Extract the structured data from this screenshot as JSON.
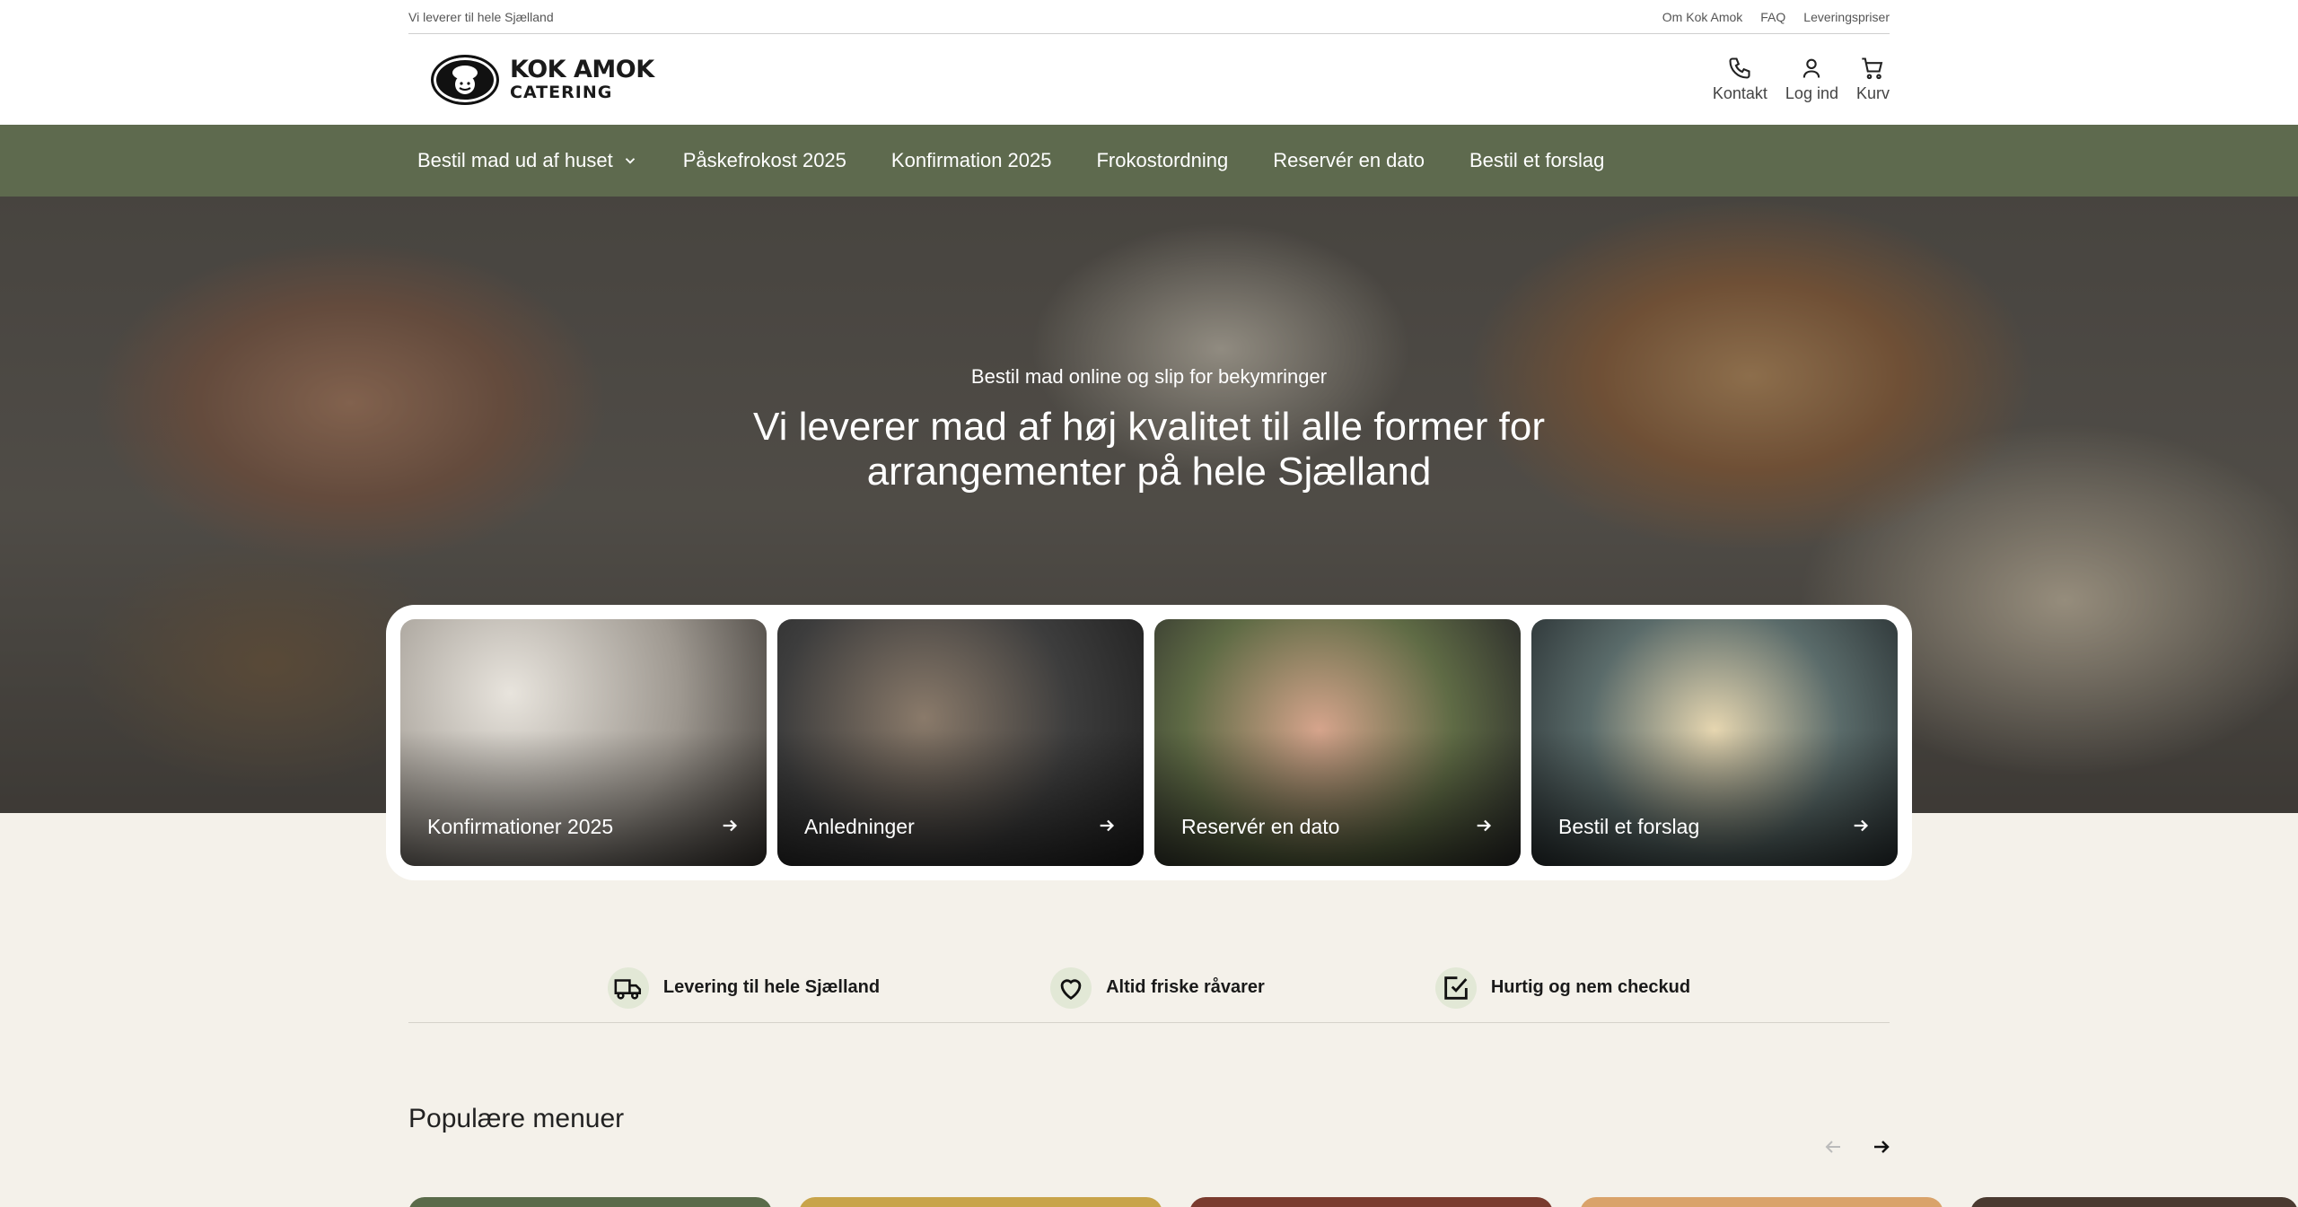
{
  "topbar": {
    "tagline": "Vi leverer til hele Sjælland",
    "links": [
      "Om Kok Amok",
      "FAQ",
      "Leveringspriser"
    ]
  },
  "header": {
    "logo_line1": "KOK AMOK",
    "logo_line2": "CATERING",
    "actions": [
      {
        "label": "Kontakt",
        "icon": "phone-icon"
      },
      {
        "label": "Log ind",
        "icon": "user-icon"
      },
      {
        "label": "Kurv",
        "icon": "cart-icon"
      }
    ]
  },
  "nav": {
    "items": [
      "Bestil mad ud af huset",
      "Påskefrokost 2025",
      "Konfirmation 2025",
      "Frokostordning",
      "Reservér en dato",
      "Bestil et forslag"
    ]
  },
  "hero": {
    "subtitle": "Bestil mad online og slip for bekymringer",
    "title_line1": "Vi leverer mad af høj kvalitet til alle former for",
    "title_line2": "arrangementer på hele Sjælland"
  },
  "cards": [
    {
      "label": "Konfirmationer 2025"
    },
    {
      "label": "Anledninger"
    },
    {
      "label": "Reservér en dato"
    },
    {
      "label": "Bestil et forslag"
    }
  ],
  "features": [
    {
      "label": "Levering til hele Sjælland",
      "icon": "truck-icon"
    },
    {
      "label": "Altid friske råvarer",
      "icon": "heart-icon"
    },
    {
      "label": "Hurtig og nem checkud",
      "icon": "check-icon"
    }
  ],
  "popular": {
    "title": "Populære menuer"
  },
  "colors": {
    "nav_bg": "#5e6a4e",
    "page_bg": "#f4f1ea",
    "feature_icon_bg": "#e2e8d6"
  }
}
